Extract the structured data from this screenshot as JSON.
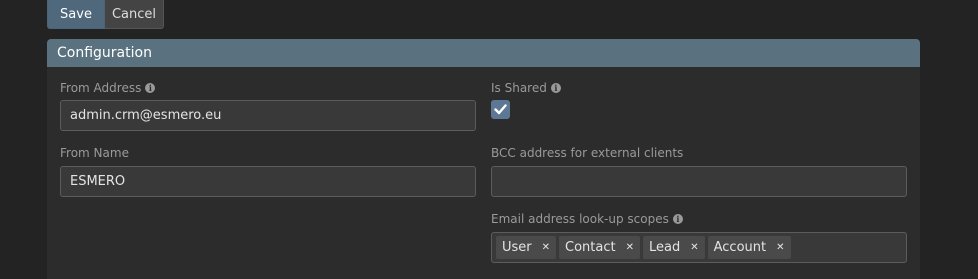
{
  "toolbar": {
    "save_label": "Save",
    "cancel_label": "Cancel"
  },
  "panel": {
    "title": "Configuration"
  },
  "fields": {
    "from_address": {
      "label": "From Address",
      "value": "admin.crm@esmero.eu"
    },
    "is_shared": {
      "label": "Is Shared",
      "checked": true
    },
    "from_name": {
      "label": "From Name",
      "value": "ESMERO"
    },
    "bcc_address": {
      "label": "BCC address for external clients",
      "value": ""
    },
    "lookup_scopes": {
      "label": "Email address look-up scopes",
      "tags": [
        "User",
        "Contact",
        "Lead",
        "Account"
      ]
    }
  },
  "icons": {
    "info": "info-icon",
    "check": "check-icon",
    "remove": "remove-icon"
  },
  "colors": {
    "accent": "#5a7280",
    "save_bg": "#50687c",
    "checkbox": "#5d7894"
  }
}
